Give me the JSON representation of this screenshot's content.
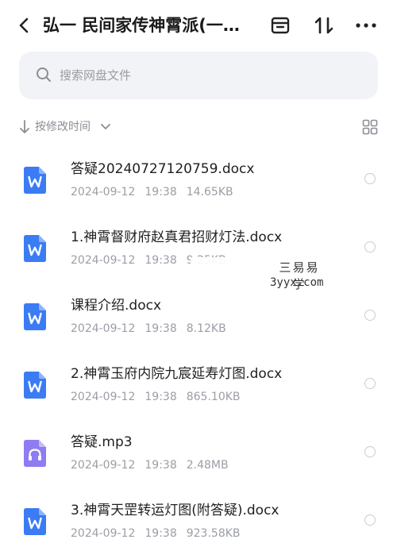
{
  "header": {
    "title": "弘一 民间家传神霄派(一…",
    "back_icon": "chevron-left-icon",
    "archive_icon": "archive-icon",
    "sort_icon": "sort-arrows-icon",
    "more_icon": "more-dots-icon"
  },
  "search": {
    "placeholder": "搜索网盘文件"
  },
  "sort": {
    "label": "按修改时间"
  },
  "files": [
    {
      "name": "答疑20240727120759.docx",
      "date": "2024-09-12",
      "time": "19:38",
      "size": "14.65KB",
      "type": "doc"
    },
    {
      "name": "1.神霄督财府赵真君招财灯法.docx",
      "date": "2024-09-12",
      "time": "19:38",
      "size": "9.25KB",
      "type": "doc"
    },
    {
      "name": "课程介绍.docx",
      "date": "2024-09-12",
      "time": "19:38",
      "size": "8.12KB",
      "type": "doc"
    },
    {
      "name": "2.神霄玉府内院九宸延寿灯图.docx",
      "date": "2024-09-12",
      "time": "19:38",
      "size": "865.10KB",
      "type": "doc"
    },
    {
      "name": "答疑.mp3",
      "date": "2024-09-12",
      "time": "19:38",
      "size": "2.48MB",
      "type": "audio"
    },
    {
      "name": "3.神霄天罡转运灯图(附答疑).docx",
      "date": "2024-09-12",
      "time": "19:38",
      "size": "923.58KB",
      "type": "doc"
    }
  ],
  "watermark": {
    "chinese": "三易易学",
    "url": "3yyx.com"
  },
  "colors": {
    "doc_blue": "#3b7cf5",
    "audio_purple": "#8d7cf2",
    "search_bg": "#f2f3f6"
  }
}
